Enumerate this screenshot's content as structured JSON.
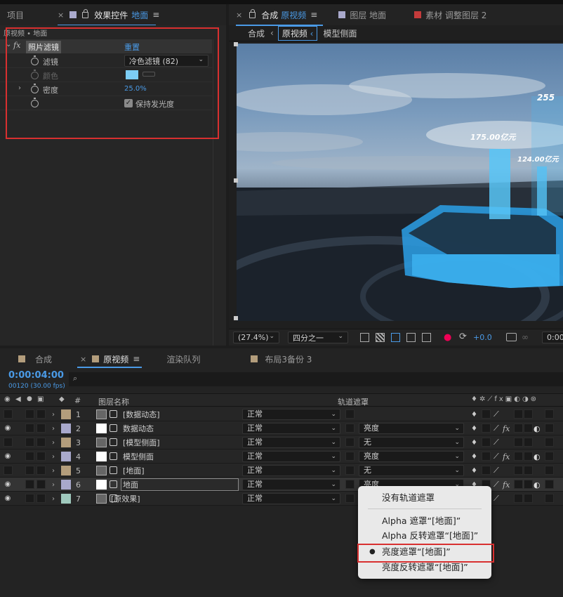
{
  "left_panel": {
    "tabs": [
      "项目",
      "效果控件",
      "地面"
    ],
    "breadcrumb": "原视频 • 地面",
    "effect": {
      "fx_label": "fx",
      "name": "照片滤镜",
      "reset": "重置",
      "props": [
        {
          "label": "滤镜",
          "value": "冷色滤镜 (82)"
        },
        {
          "label": "颜色",
          "value": ""
        },
        {
          "label": "密度",
          "value": "25.0%"
        },
        {
          "label": "",
          "value": "保持发光度"
        }
      ]
    }
  },
  "comp_panel": {
    "tab_title": "合成",
    "tab_comp": "原视频",
    "tab_layer": "图层 地面",
    "tab_footage": "素材 调整图层 2",
    "breadcrumbs": [
      "合成",
      "原视频",
      "模型侧面"
    ],
    "labels": [
      "255",
      "175.00亿元",
      "124.00亿元"
    ],
    "toolbar": {
      "zoom": "(27.4%)",
      "resolution": "四分之一",
      "exposure": "+0.0",
      "time": "0:00"
    }
  },
  "timeline": {
    "tabs": [
      "合成",
      "原视频",
      "渲染队列",
      "布局3备份 3"
    ],
    "timecode": "0:00:04:00",
    "frame_info": "00120 (30.00 fps)",
    "search_placeholder": "",
    "columns": {
      "num": "#",
      "name": "图层名称",
      "matte": "轨道遮罩"
    },
    "layers": [
      {
        "num": "1",
        "name": "[数据动态]",
        "mode": "正常",
        "matte": "",
        "eye": false,
        "color": "#b39d7c"
      },
      {
        "num": "2",
        "name": "数据动态",
        "mode": "正常",
        "matte": "亮度",
        "eye": true,
        "color": "#a9a9cc"
      },
      {
        "num": "3",
        "name": "[模型侧面]",
        "mode": "正常",
        "matte": "无",
        "eye": false,
        "color": "#b39d7c"
      },
      {
        "num": "4",
        "name": "模型侧面",
        "mode": "正常",
        "matte": "亮度",
        "eye": true,
        "color": "#a9a9cc"
      },
      {
        "num": "5",
        "name": "[地面]",
        "mode": "正常",
        "matte": "无",
        "eye": false,
        "color": "#b39d7c"
      },
      {
        "num": "6",
        "name": "地面",
        "mode": "正常",
        "matte": "亮度",
        "eye": true,
        "color": "#a9a9cc"
      },
      {
        "num": "7",
        "name": "[原效果]",
        "mode": "正常",
        "matte": "",
        "eye": true,
        "color": "#9fc9bd"
      }
    ]
  },
  "matte_menu": {
    "items": [
      "没有轨道遮罩",
      "Alpha 遮罩“[地面]”",
      "Alpha 反转遮罩“[地面]”",
      "亮度遮罩“[地面]”",
      "亮度反转遮罩“[地面]”"
    ],
    "selected_index": 3
  },
  "colors": {
    "accent": "#4a9ae6",
    "highlight": "#d83030"
  }
}
